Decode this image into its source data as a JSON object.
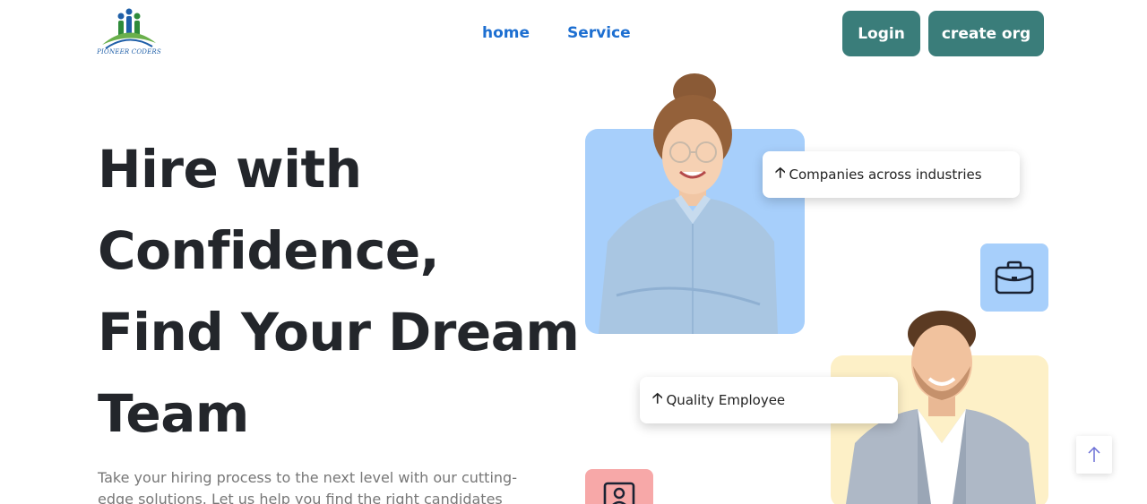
{
  "header": {
    "logo_text": "PIONEER CODERS",
    "nav": [
      {
        "label": "home"
      },
      {
        "label": "Service"
      }
    ],
    "login_label": "Login",
    "create_org_label": "create org"
  },
  "hero": {
    "title": "Hire with Confidence, Find Your Dream Team",
    "description": "Take your hiring process to the next level with our cutting-edge solutions. Let us help you find the right candidates"
  },
  "stats": [
    {
      "label": "Companies across industries"
    },
    {
      "label": "Quality Employee"
    }
  ],
  "icons": {
    "briefcase": "briefcase-icon",
    "profile": "user-card-icon",
    "scroll": "arrow-up-icon"
  },
  "colors": {
    "accent_button": "#3a7d7a",
    "nav_link": "#1d6fd1",
    "card_blue": "#a7cffb",
    "card_yellow": "#fdf0c7",
    "card_pink": "#f7a8a8"
  }
}
